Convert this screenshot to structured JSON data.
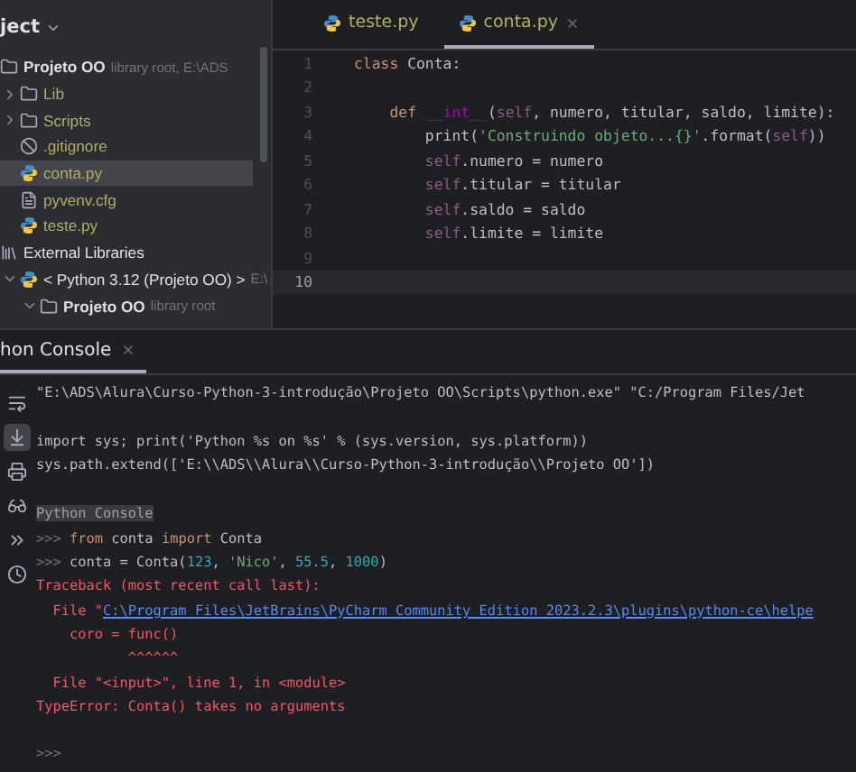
{
  "project": {
    "header": "ject",
    "tree": [
      {
        "name": "Projeto OO",
        "hint": "library root, E:\\ADS",
        "kind": "folder",
        "bold": true,
        "selected": false,
        "children": [
          {
            "name": "Lib",
            "kind": "folder",
            "expanded": false,
            "selected": false
          },
          {
            "name": "Scripts",
            "kind": "folder",
            "expanded": false,
            "selected": false
          },
          {
            "name": ".gitignore",
            "kind": "ignore",
            "selected": false
          },
          {
            "name": "conta.py",
            "kind": "python",
            "selected": true
          },
          {
            "name": "pyvenv.cfg",
            "kind": "config",
            "selected": false
          },
          {
            "name": "teste.py",
            "kind": "python",
            "selected": false
          }
        ]
      },
      {
        "name": "External Libraries",
        "kind": "library",
        "selected": false,
        "children": [
          {
            "name": "< Python 3.12 (Projeto OO) >",
            "hint": "E:\\",
            "kind": "python",
            "expanded": true,
            "selected": false,
            "children": [
              {
                "name": "Projeto OO",
                "hint": "library root",
                "kind": "folder",
                "bold": true,
                "expanded": true,
                "selected": false
              }
            ]
          }
        ]
      }
    ]
  },
  "editor": {
    "tabs": [
      {
        "label": "teste.py",
        "selected": false,
        "closable": false
      },
      {
        "label": "conta.py",
        "selected": true,
        "closable": true
      }
    ],
    "lines": [
      {
        "number": "1",
        "current": false,
        "tokens": [
          {
            "kind": "kw",
            "text": "class "
          },
          {
            "kind": "plain",
            "text": "Conta:"
          }
        ]
      },
      {
        "number": "2",
        "current": false
      },
      {
        "number": "3",
        "current": false,
        "tokens": [
          {
            "kind": "kw",
            "text": "    def "
          },
          {
            "kind": "fn",
            "text": "__int__"
          },
          {
            "kind": "plain",
            "text": "("
          },
          {
            "kind": "self",
            "text": "self"
          },
          {
            "kind": "plain",
            "text": ", numero, titular, saldo, limite):"
          }
        ]
      },
      {
        "number": "4",
        "current": false,
        "tokens": [
          {
            "kind": "plain",
            "text": "        print("
          },
          {
            "kind": "str",
            "text": "'Construindo objeto...{}'"
          },
          {
            "kind": "plain",
            "text": ".format("
          },
          {
            "kind": "self",
            "text": "self"
          },
          {
            "kind": "plain",
            "text": "))"
          }
        ]
      },
      {
        "number": "5",
        "current": false,
        "tokens": [
          {
            "kind": "self",
            "text": "        self"
          },
          {
            "kind": "plain",
            "text": ".numero = numero"
          }
        ]
      },
      {
        "number": "6",
        "current": false,
        "tokens": [
          {
            "kind": "self",
            "text": "        self"
          },
          {
            "kind": "plain",
            "text": ".titular = titular"
          }
        ]
      },
      {
        "number": "7",
        "current": false,
        "tokens": [
          {
            "kind": "self",
            "text": "        self"
          },
          {
            "kind": "plain",
            "text": ".saldo = saldo"
          }
        ]
      },
      {
        "number": "8",
        "current": false,
        "tokens": [
          {
            "kind": "self",
            "text": "        self"
          },
          {
            "kind": "plain",
            "text": ".limite = limite"
          }
        ]
      },
      {
        "number": "9",
        "current": false
      },
      {
        "number": "10",
        "current": true
      }
    ]
  },
  "console": {
    "tab": {
      "label": "hon Console",
      "selected": true
    },
    "tools": [
      {
        "kind": "wrap",
        "on": false
      },
      {
        "kind": "scroll-end",
        "on": true
      },
      {
        "kind": "print",
        "on": false
      },
      {
        "kind": "glasses",
        "on": false
      },
      {
        "kind": "prompt",
        "on": false
      },
      {
        "kind": "history",
        "on": false
      }
    ],
    "lines": [
      {
        "tokens": [
          {
            "kind": "plain",
            "text": "\"E:\\ADS\\Alura\\Curso-Python-3-introdução\\Projeto OO\\Scripts\\python.exe\" \"C:/Program Files/Jet"
          }
        ]
      },
      {
        "blank_before": true,
        "tokens": [
          {
            "kind": "plain",
            "text": "import sys; print('Python %s on %s' % (sys.version, sys.platform))"
          }
        ]
      },
      {
        "tokens": [
          {
            "kind": "plain",
            "text": "sys.path.extend(['E:\\\\ADS\\\\Alura\\\\Curso-Python-3-introdução\\\\Projeto OO'])"
          }
        ]
      },
      {
        "blank_before": true,
        "tokens": [
          {
            "kind": "banner",
            "text": "Python Console"
          }
        ]
      },
      {
        "tokens": [
          {
            "kind": "prompt",
            "text": ">>> "
          },
          {
            "kind": "kw",
            "text": "from "
          },
          {
            "kind": "plain",
            "text": "conta "
          },
          {
            "kind": "kw",
            "text": "import "
          },
          {
            "kind": "plain",
            "text": "Conta"
          }
        ]
      },
      {
        "tokens": [
          {
            "kind": "prompt",
            "text": ">>> "
          },
          {
            "kind": "plain",
            "text": "conta = Conta("
          },
          {
            "kind": "num",
            "text": "123"
          },
          {
            "kind": "plain",
            "text": ", "
          },
          {
            "kind": "str",
            "text": "'Nico'"
          },
          {
            "kind": "plain",
            "text": ", "
          },
          {
            "kind": "num",
            "text": "55.5"
          },
          {
            "kind": "plain",
            "text": ", "
          },
          {
            "kind": "num",
            "text": "1000"
          },
          {
            "kind": "plain",
            "text": ")"
          }
        ]
      },
      {
        "tokens": [
          {
            "kind": "err",
            "text": "Traceback (most recent call last):"
          }
        ]
      },
      {
        "tokens": [
          {
            "kind": "err",
            "text": "  File \""
          },
          {
            "kind": "link",
            "text": "C:\\Program Files\\JetBrains\\PyCharm Community Edition 2023.2.3\\plugins\\python-ce\\helpe"
          }
        ]
      },
      {
        "tokens": [
          {
            "kind": "err",
            "text": "    coro = func()"
          }
        ]
      },
      {
        "tokens": [
          {
            "kind": "err",
            "text": "           ^^^^^^"
          }
        ]
      },
      {
        "tokens": [
          {
            "kind": "err",
            "text": "  File \"<input>\", line 1, in <module>"
          }
        ]
      },
      {
        "tokens": [
          {
            "kind": "err",
            "text": "TypeError: Conta() takes no arguments"
          }
        ]
      },
      {
        "tokens": [
          {
            "kind": "prompt",
            "text": ">>>"
          }
        ]
      }
    ]
  }
}
